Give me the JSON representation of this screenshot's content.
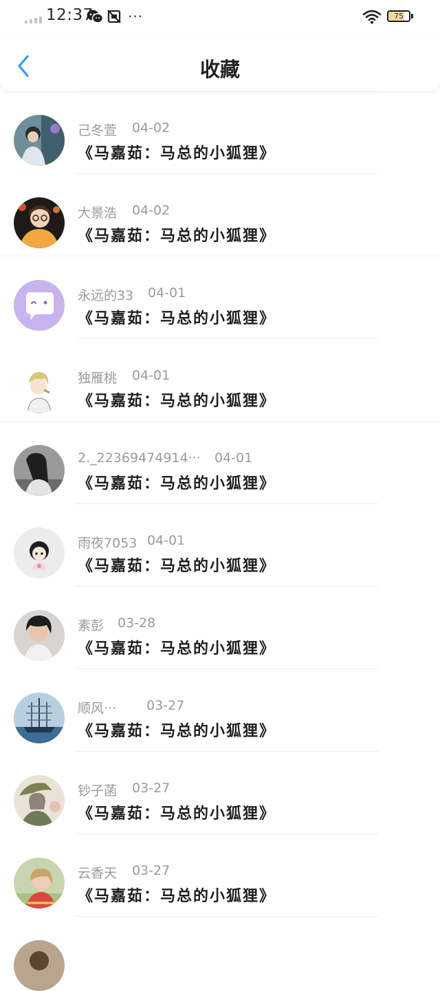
{
  "status_bar": {
    "time": "12:37",
    "dots": "···",
    "battery_level": "75"
  },
  "header": {
    "title": "收藏",
    "back_icon": "chevron-left-icon",
    "accent_color": "#2d9cff"
  },
  "items": [
    {
      "name": "己冬萱",
      "date": "04-02",
      "title": "《马嘉茹：马总的小狐狸》"
    },
    {
      "name": "大景浩",
      "date": "04-02",
      "title": "《马嘉茹：马总的小狐狸》"
    },
    {
      "name": "永远的33",
      "date": "04-01",
      "title": "《马嘉茹：马总的小狐狸》"
    },
    {
      "name": "独雁桃",
      "date": "04-01",
      "title": "《马嘉茹：马总的小狐狸》"
    },
    {
      "name": "2._22369474914···",
      "date": "04-01",
      "title": "《马嘉茹：马总的小狐狸》"
    },
    {
      "name": "雨夜7053",
      "date": "04-01",
      "title": "《马嘉茹：马总的小狐狸》"
    },
    {
      "name": "素彭",
      "date": "03-28",
      "title": "《马嘉茹：马总的小狐狸》"
    },
    {
      "name": "顺风···",
      "date": "03-27",
      "title": "《马嘉茹：马总的小狐狸》"
    },
    {
      "name": "钞子菡",
      "date": "03-27",
      "title": "《马嘉茹：马总的小狐狸》"
    },
    {
      "name": "云香天",
      "date": "03-27",
      "title": "《马嘉茹：马总的小狐狸》"
    }
  ]
}
